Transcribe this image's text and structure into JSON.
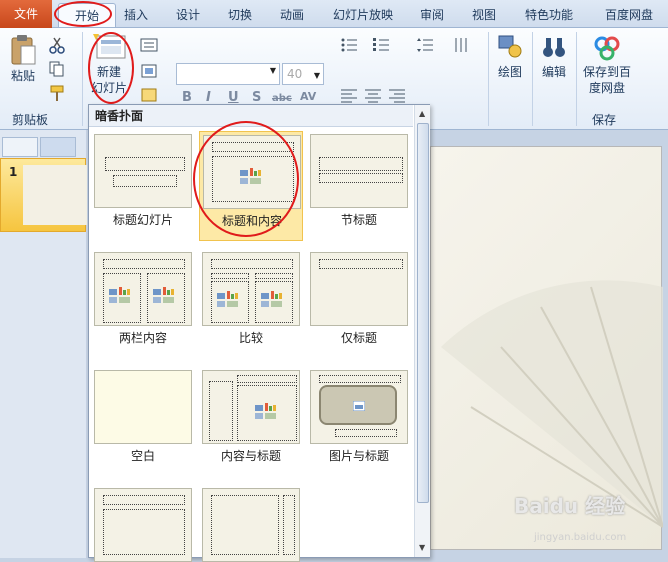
{
  "tabs": [
    "文件",
    "开始",
    "插入",
    "设计",
    "切换",
    "动画",
    "幻灯片放映",
    "审阅",
    "视图",
    "特色功能",
    "百度网盘"
  ],
  "ribbon": {
    "paste_label": "粘贴",
    "clipboard_label": "剪贴板",
    "new_slide_line1": "新建",
    "new_slide_line2": "幻灯片",
    "font_size": "40",
    "draw_label": "绘图",
    "edit_label": "编辑",
    "save_to_label_1": "保存到百",
    "save_to_label_2": "度网盘",
    "save_group_label": "保存"
  },
  "slide_panel": {
    "number": "1"
  },
  "dropdown": {
    "theme_name": "暗香扑面",
    "layouts": [
      "标题幻灯片",
      "标题和内容",
      "节标题",
      "两栏内容",
      "比较",
      "仅标题",
      "空白",
      "内容与标题",
      "图片与标题"
    ]
  },
  "watermark": {
    "brand": "Baidu 经验",
    "url": "jingyan.baidu.com"
  },
  "colors": {
    "accent": "#e36a3c",
    "highlight": "#f6c53f",
    "annotation": "#e01b1b"
  }
}
